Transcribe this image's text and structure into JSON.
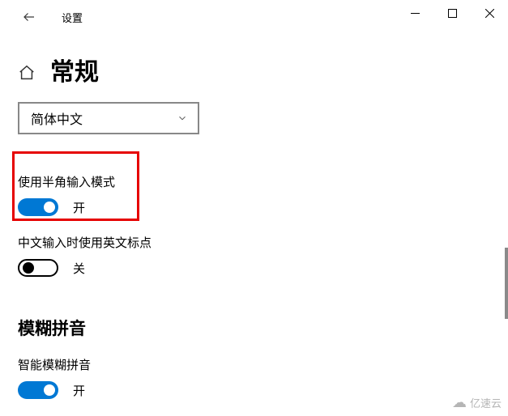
{
  "titlebar": {
    "title": "设置"
  },
  "header": {
    "page_title": "常规"
  },
  "dropdown": {
    "selected": "简体中文"
  },
  "settings": {
    "halfwidth": {
      "label": "使用半角输入模式",
      "state": "开",
      "on": true
    },
    "english_punct": {
      "label": "中文输入时使用英文标点",
      "state": "关",
      "on": false
    }
  },
  "fuzzy": {
    "section_title": "模糊拼音",
    "smart": {
      "label": "智能模糊拼音",
      "state": "开",
      "on": true
    }
  },
  "watermark": "亿速云"
}
